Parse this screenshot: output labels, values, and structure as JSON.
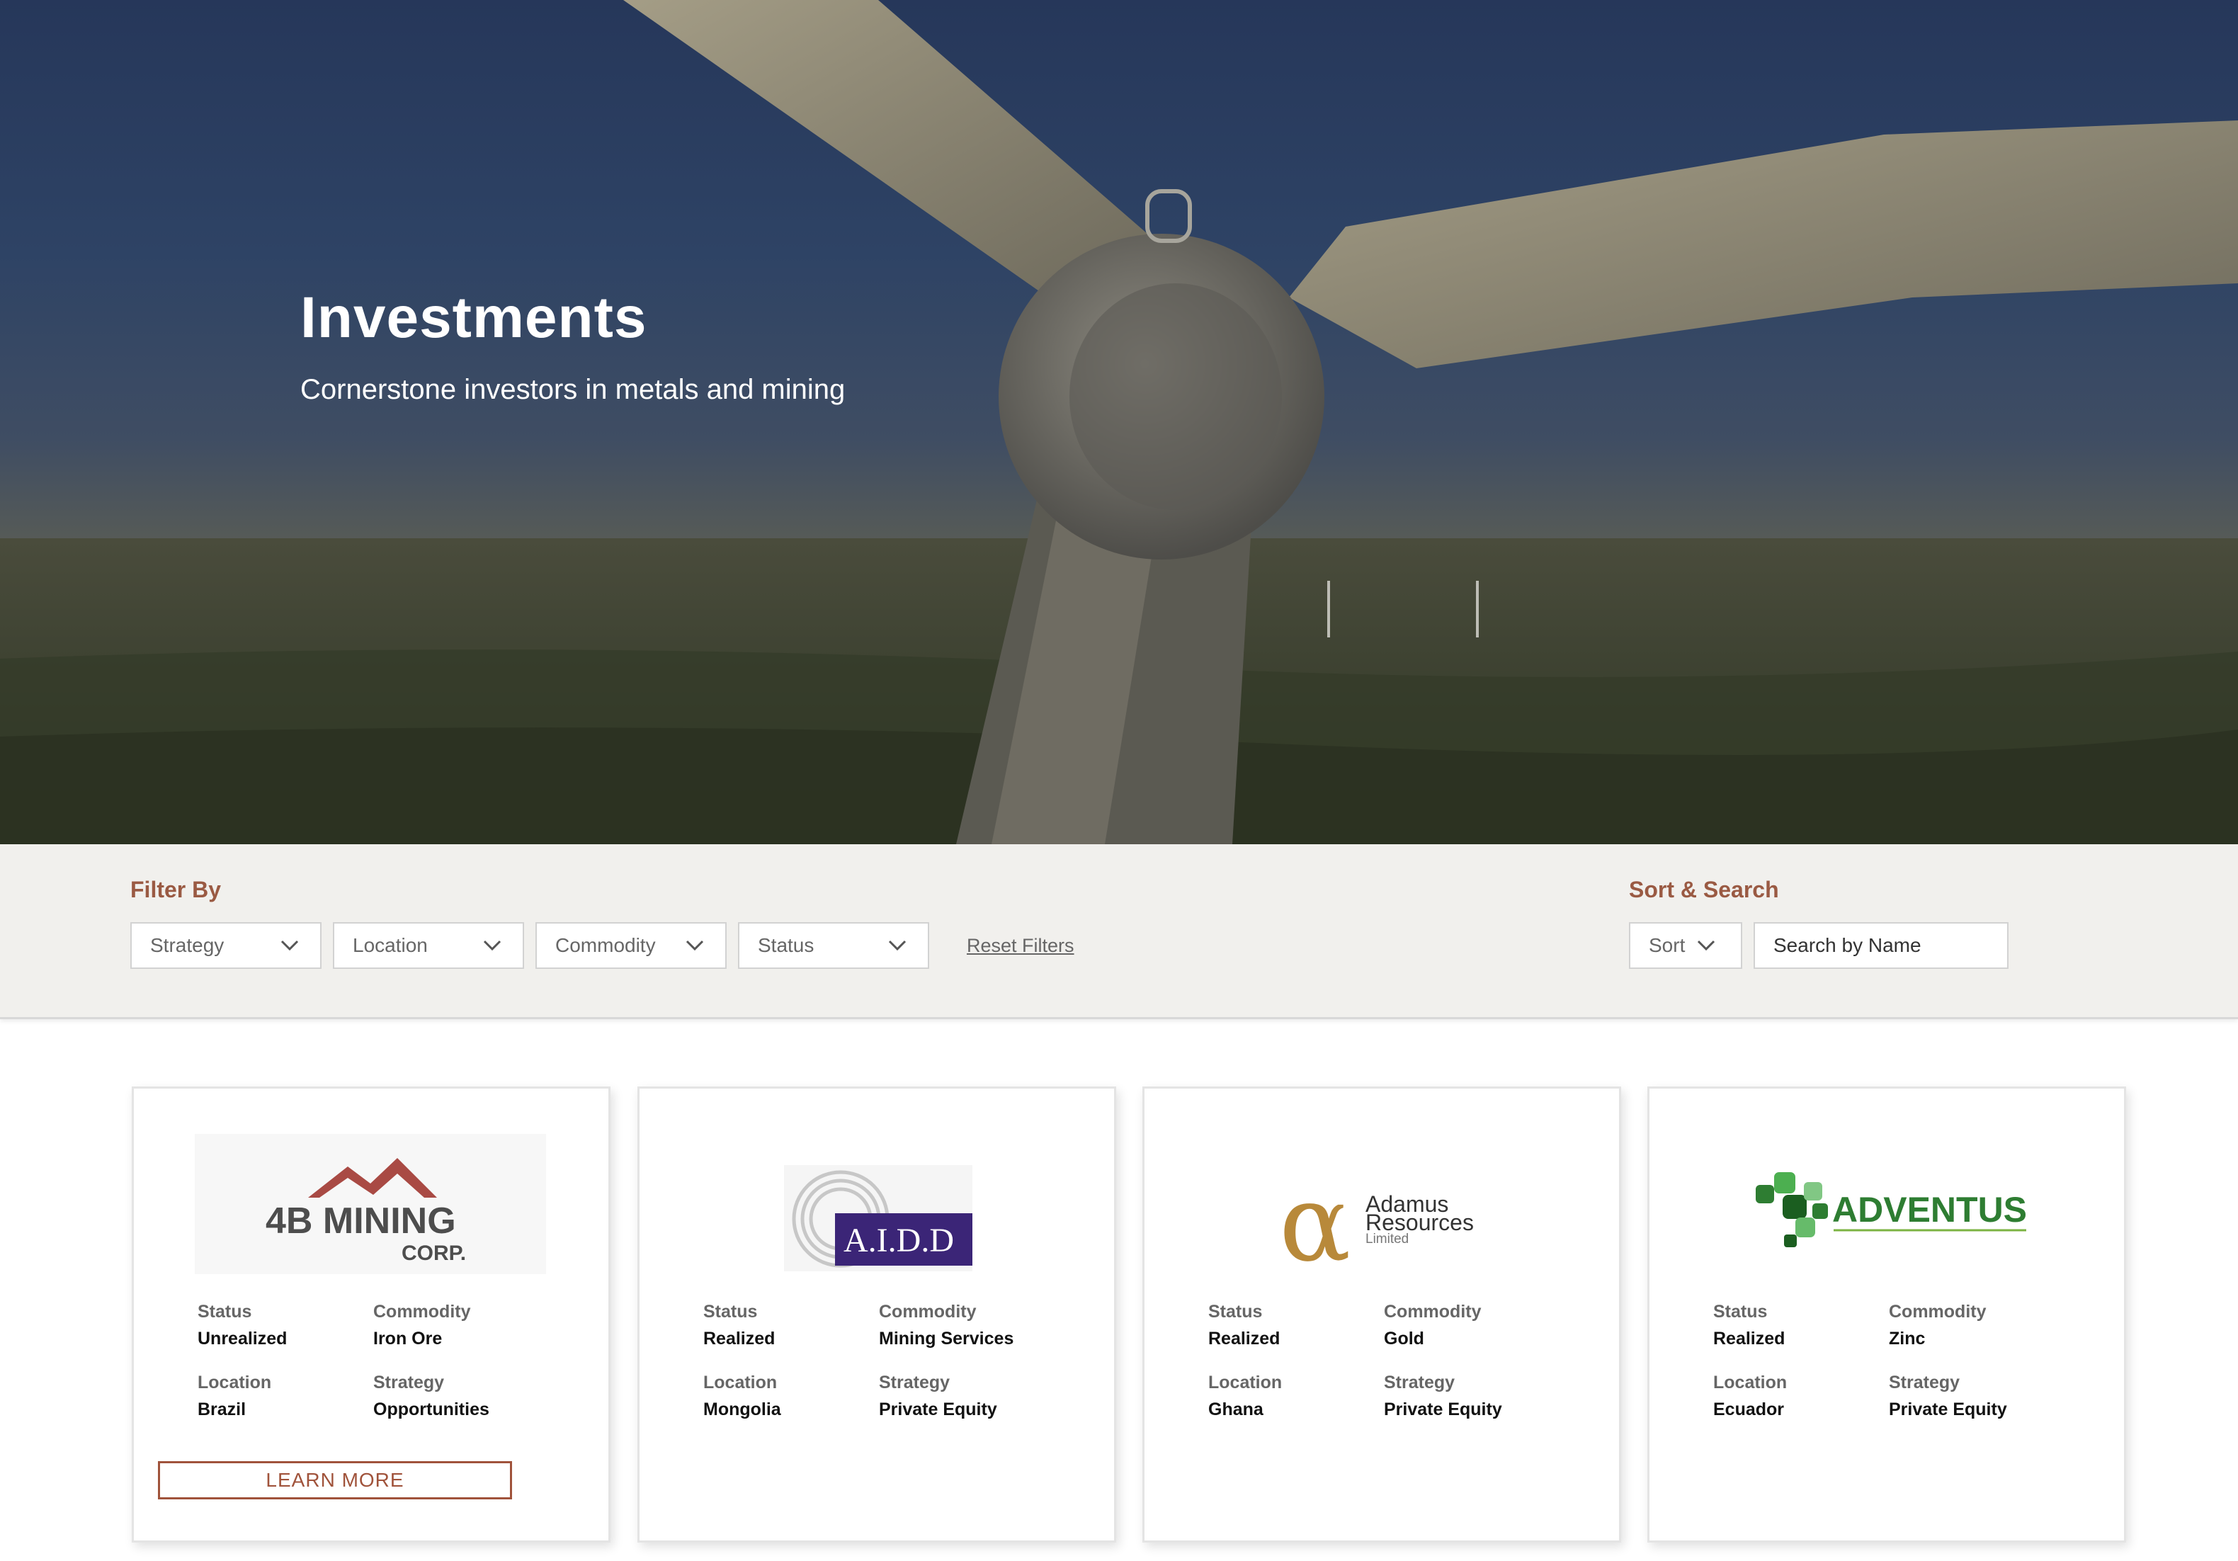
{
  "hero": {
    "title": "Investments",
    "subtitle": "Cornerstone investors in metals and mining"
  },
  "filter": {
    "label": "Filter By",
    "selects": [
      "Strategy",
      "Location",
      "Commodity",
      "Status"
    ],
    "reset_label": "Reset Filters"
  },
  "sort_search": {
    "label": "Sort & Search",
    "sort_label": "Sort",
    "search_placeholder": "Search by Name"
  },
  "field_labels": {
    "status": "Status",
    "commodity": "Commodity",
    "location": "Location",
    "strategy": "Strategy"
  },
  "cards": [
    {
      "logo_lines": [
        "4B MINING",
        "CORP."
      ],
      "status": "Unrealized",
      "commodity": "Iron Ore",
      "location": "Brazil",
      "strategy": "Opportunities",
      "cta": "LEARN MORE"
    },
    {
      "logo_lines": [
        "A.I.D.D"
      ],
      "status": "Realized",
      "commodity": "Mining Services",
      "location": "Mongolia",
      "strategy": "Private Equity"
    },
    {
      "logo_lines": [
        "Adamus",
        "Resources",
        "Limited"
      ],
      "status": "Realized",
      "commodity": "Gold",
      "location": "Ghana",
      "strategy": "Private Equity"
    },
    {
      "logo_lines": [
        "ADVENTUS"
      ],
      "status": "Realized",
      "commodity": "Zinc",
      "location": "Ecuador",
      "strategy": "Private Equity"
    }
  ],
  "colors": {
    "accent": "#9a5a43",
    "filter_bg": "#f1f0ed",
    "adventus_green": "#2e7d32",
    "aidd_purple": "#3b2577",
    "adamus_gold": "#b8893a",
    "fourb_red": "#a94a44"
  }
}
